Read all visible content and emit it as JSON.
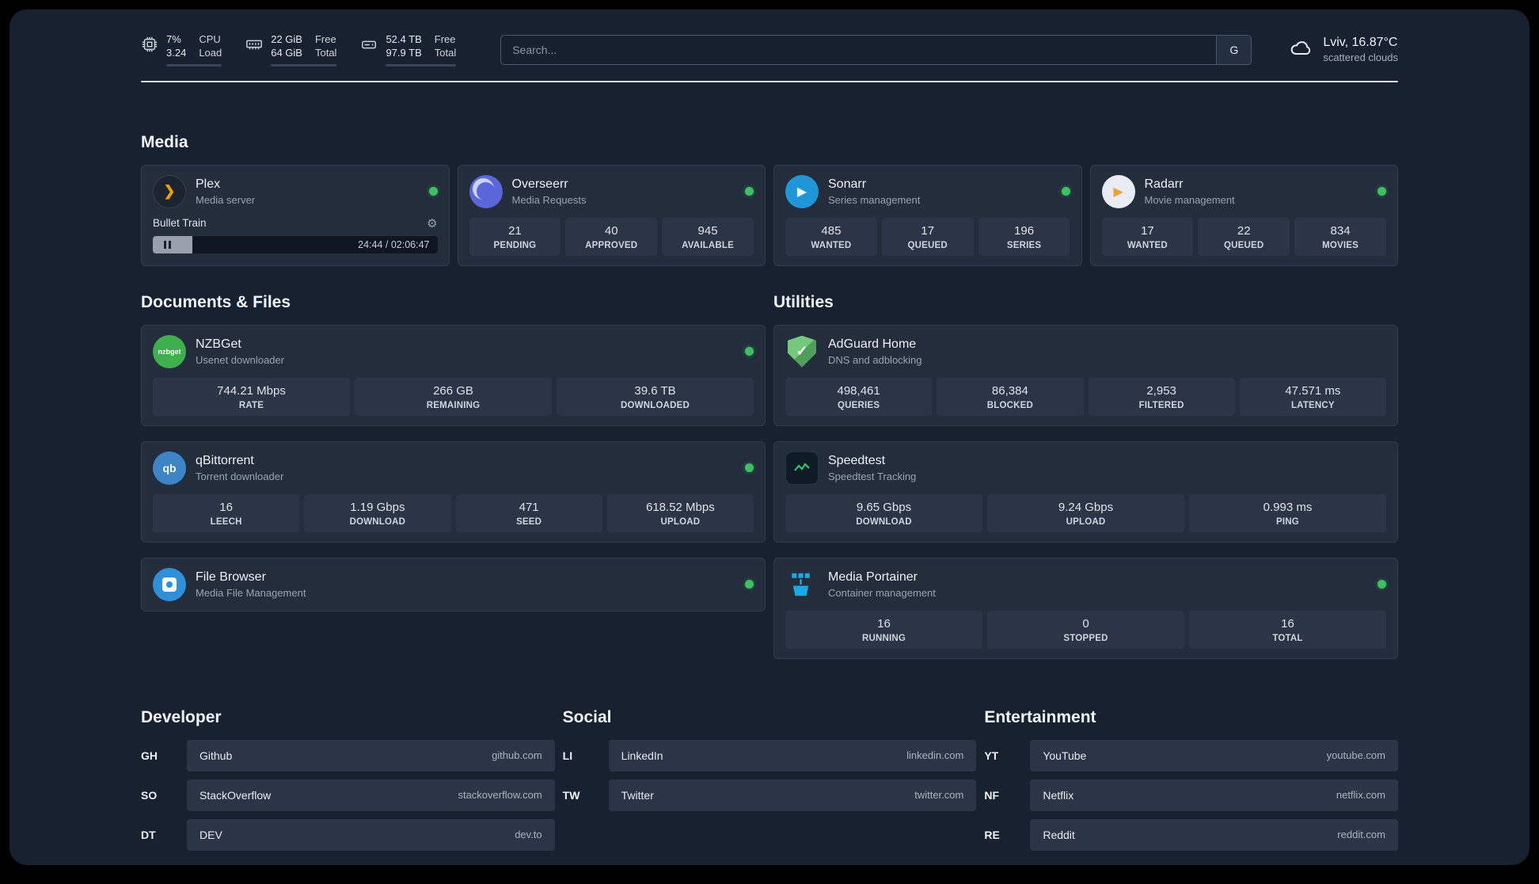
{
  "topbar": {
    "cpu": {
      "percent": "7%",
      "load": "3.24",
      "label_percent": "CPU",
      "label_load": "Load",
      "progress": 7
    },
    "ram": {
      "free": "22 GiB",
      "total": "64 GiB",
      "label_free": "Free",
      "label_total": "Total",
      "progress": 34
    },
    "disk": {
      "free": "52.4 TB",
      "total": "97.9 TB",
      "label_free": "Free",
      "label_total": "Total",
      "progress": 53
    },
    "search": {
      "placeholder": "Search...",
      "button_label": "G"
    },
    "weather": {
      "location": "Lviv, 16.87°C",
      "condition": "scattered clouds"
    }
  },
  "sections": {
    "media": "Media",
    "documents": "Documents & Files",
    "utilities": "Utilities"
  },
  "apps": {
    "plex": {
      "name": "Plex",
      "subtitle": "Media server",
      "now_playing": "Bullet Train",
      "time": "24:44 / 02:06:47",
      "progress": 14
    },
    "overseerr": {
      "name": "Overseerr",
      "subtitle": "Media Requests",
      "stats": [
        {
          "value": "21",
          "label": "PENDING"
        },
        {
          "value": "40",
          "label": "APPROVED"
        },
        {
          "value": "945",
          "label": "AVAILABLE"
        }
      ]
    },
    "sonarr": {
      "name": "Sonarr",
      "subtitle": "Series management",
      "stats": [
        {
          "value": "485",
          "label": "WANTED"
        },
        {
          "value": "17",
          "label": "QUEUED"
        },
        {
          "value": "196",
          "label": "SERIES"
        }
      ]
    },
    "radarr": {
      "name": "Radarr",
      "subtitle": "Movie management",
      "stats": [
        {
          "value": "17",
          "label": "WANTED"
        },
        {
          "value": "22",
          "label": "QUEUED"
        },
        {
          "value": "834",
          "label": "MOVIES"
        }
      ]
    },
    "nzbget": {
      "name": "NZBGet",
      "subtitle": "Usenet downloader",
      "icon_text": "nzbget",
      "stats": [
        {
          "value": "744.21 Mbps",
          "label": "RATE"
        },
        {
          "value": "266 GB",
          "label": "REMAINING"
        },
        {
          "value": "39.6 TB",
          "label": "DOWNLOADED"
        }
      ]
    },
    "qbittorrent": {
      "name": "qBittorrent",
      "subtitle": "Torrent downloader",
      "icon_text": "qb",
      "stats": [
        {
          "value": "16",
          "label": "LEECH"
        },
        {
          "value": "1.19 Gbps",
          "label": "DOWNLOAD"
        },
        {
          "value": "471",
          "label": "SEED"
        },
        {
          "value": "618.52 Mbps",
          "label": "UPLOAD"
        }
      ]
    },
    "filebrowser": {
      "name": "File Browser",
      "subtitle": "Media File Management"
    },
    "adguard": {
      "name": "AdGuard Home",
      "subtitle": "DNS and adblocking",
      "stats": [
        {
          "value": "498,461",
          "label": "QUERIES"
        },
        {
          "value": "86,384",
          "label": "BLOCKED"
        },
        {
          "value": "2,953",
          "label": "FILTERED"
        },
        {
          "value": "47.571 ms",
          "label": "LATENCY"
        }
      ]
    },
    "speedtest": {
      "name": "Speedtest",
      "subtitle": "Speedtest Tracking",
      "stats": [
        {
          "value": "9.65 Gbps",
          "label": "DOWNLOAD"
        },
        {
          "value": "9.24 Gbps",
          "label": "UPLOAD"
        },
        {
          "value": "0.993 ms",
          "label": "PING"
        }
      ]
    },
    "portainer": {
      "name": "Media Portainer",
      "subtitle": "Container management",
      "stats": [
        {
          "value": "16",
          "label": "RUNNING"
        },
        {
          "value": "0",
          "label": "STOPPED"
        },
        {
          "value": "16",
          "label": "TOTAL"
        }
      ]
    }
  },
  "bookmarks": {
    "developer": {
      "title": "Developer",
      "items": [
        {
          "abbr": "GH",
          "name": "Github",
          "url": "github.com"
        },
        {
          "abbr": "SO",
          "name": "StackOverflow",
          "url": "stackoverflow.com"
        },
        {
          "abbr": "DT",
          "name": "DEV",
          "url": "dev.to"
        }
      ]
    },
    "social": {
      "title": "Social",
      "items": [
        {
          "abbr": "LI",
          "name": "LinkedIn",
          "url": "linkedin.com"
        },
        {
          "abbr": "TW",
          "name": "Twitter",
          "url": "twitter.com"
        }
      ]
    },
    "entertainment": {
      "title": "Entertainment",
      "items": [
        {
          "abbr": "YT",
          "name": "YouTube",
          "url": "youtube.com"
        },
        {
          "abbr": "NF",
          "name": "Netflix",
          "url": "netflix.com"
        },
        {
          "abbr": "RE",
          "name": "Reddit",
          "url": "reddit.com"
        }
      ]
    }
  },
  "colors": {
    "status_online": "#3fc060",
    "plex_accent": "#e5a00d",
    "background": "#182130"
  }
}
